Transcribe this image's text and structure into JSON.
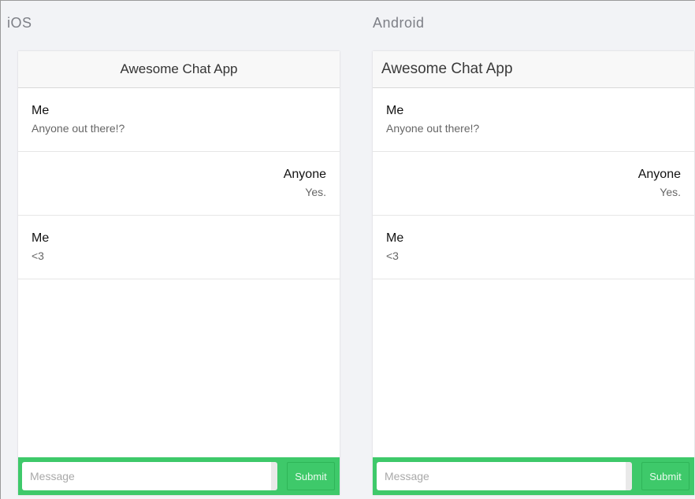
{
  "ios": {
    "platform_label": "iOS",
    "app_title": "Awesome Chat App",
    "messages": [
      {
        "sender": "Me",
        "text": "Anyone out there!?"
      },
      {
        "sender": "Anyone",
        "text": "Yes."
      },
      {
        "sender": "Me",
        "text": "<3"
      }
    ],
    "composer": {
      "placeholder": "Message",
      "submit_label": "Submit"
    }
  },
  "android": {
    "platform_label": "Android",
    "app_title": "Awesome Chat App",
    "messages": [
      {
        "sender": "Me",
        "text": "Anyone out there!?"
      },
      {
        "sender": "Anyone",
        "text": "Yes."
      },
      {
        "sender": "Me",
        "text": "<3"
      }
    ],
    "composer": {
      "placeholder": "Message",
      "submit_label": "Submit"
    }
  },
  "colors": {
    "accent_green": "#3ec96a",
    "background": "#f2f3f6",
    "app_bar": "#f8f8f8"
  }
}
